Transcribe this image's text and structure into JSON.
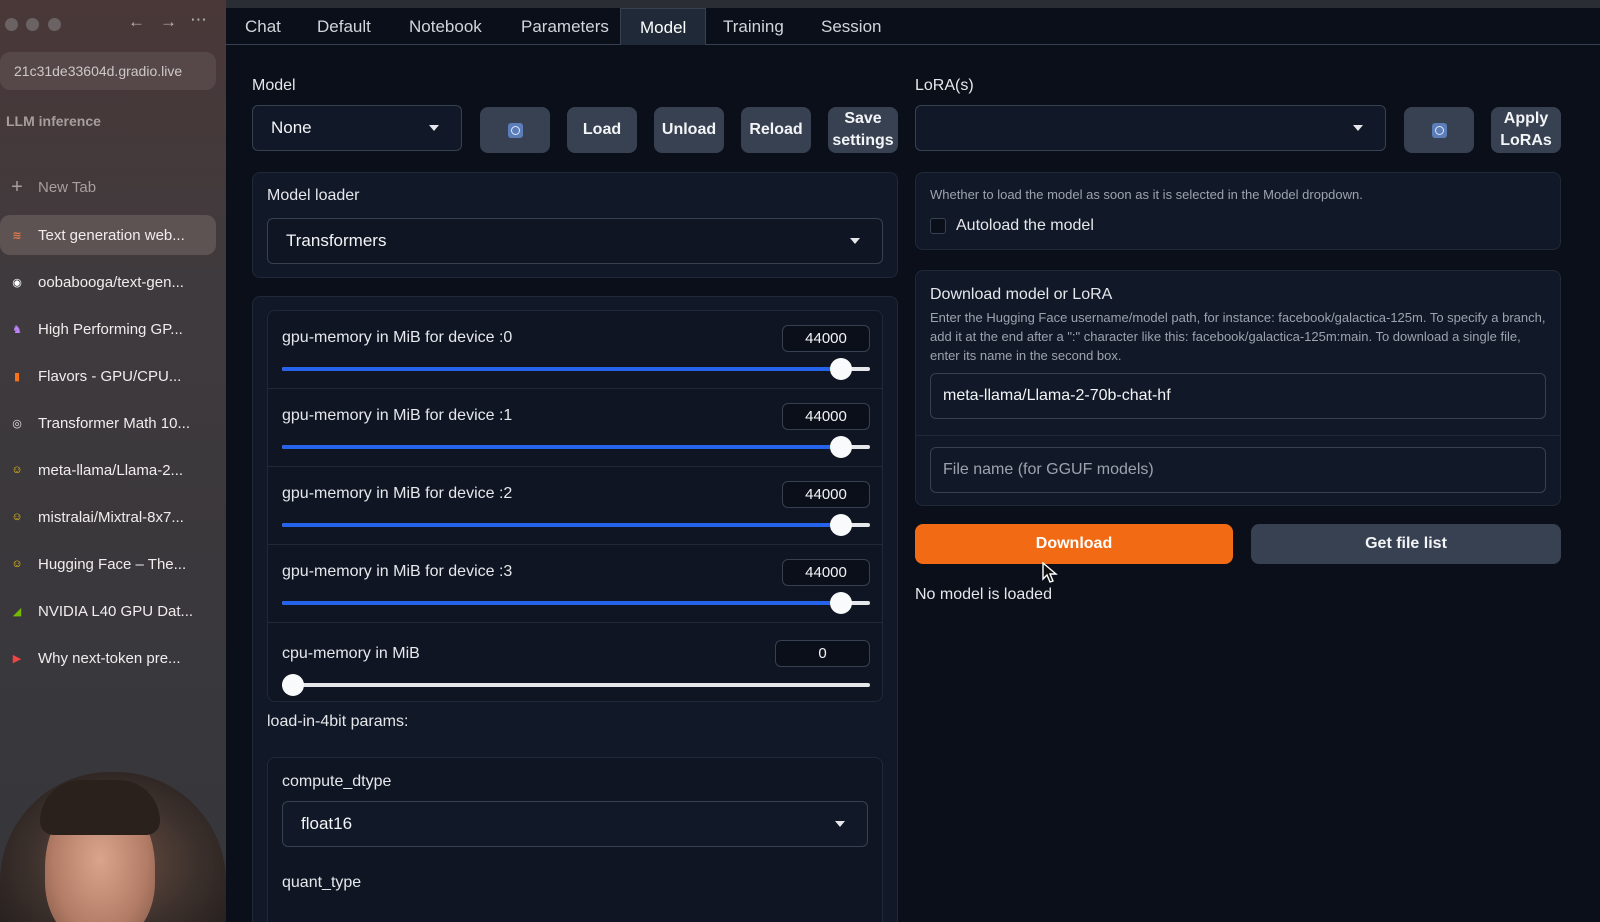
{
  "browser": {
    "url": "21c31de33604d.gradio.live",
    "space_name": "LLM inference",
    "new_tab_label": "New Tab",
    "tabs": [
      {
        "label": "Text generation web...",
        "icon": "stack-icon",
        "color": "#e07a4a",
        "active": true
      },
      {
        "label": "oobabooga/text-gen...",
        "icon": "github-icon",
        "color": "#ffffff",
        "active": false
      },
      {
        "label": "High Performing GP...",
        "icon": "fox-icon",
        "color": "#c084fc",
        "active": false
      },
      {
        "label": "Flavors - GPU/CPU...",
        "icon": "brand-icon",
        "color": "#f97316",
        "active": false
      },
      {
        "label": "Transformer Math 10...",
        "icon": "gear-circle-icon",
        "color": "#e5e7eb",
        "active": false
      },
      {
        "label": "meta-llama/Llama-2...",
        "icon": "hugging-face-icon",
        "color": "#facc15",
        "active": false
      },
      {
        "label": "mistralai/Mixtral-8x7...",
        "icon": "hugging-face-icon",
        "color": "#facc15",
        "active": false
      },
      {
        "label": "Hugging Face – The...",
        "icon": "hugging-face-icon",
        "color": "#facc15",
        "active": false
      },
      {
        "label": "NVIDIA L40 GPU Dat...",
        "icon": "nvidia-icon",
        "color": "#76b900",
        "active": false
      },
      {
        "label": "Why next-token pre...",
        "icon": "youtube-icon",
        "color": "#ef4444",
        "active": false
      }
    ]
  },
  "tabs": [
    "Chat",
    "Default",
    "Notebook",
    "Parameters",
    "Model",
    "Training",
    "Session"
  ],
  "selected_tab": "Model",
  "model": {
    "label": "Model",
    "selected": "None",
    "buttons": {
      "load": "Load",
      "unload": "Unload",
      "reload": "Reload",
      "save": "Save settings"
    }
  },
  "lora": {
    "label": "LoRA(s)",
    "selected": "",
    "apply_label": "Apply LoRAs"
  },
  "loader": {
    "label": "Model loader",
    "selected": "Transformers"
  },
  "gpu_memory": [
    {
      "label": "gpu-memory in MiB for device :0",
      "value": "44000",
      "fraction": 0.95
    },
    {
      "label": "gpu-memory in MiB for device :1",
      "value": "44000",
      "fraction": 0.95
    },
    {
      "label": "gpu-memory in MiB for device :2",
      "value": "44000",
      "fraction": 0.95
    },
    {
      "label": "gpu-memory in MiB for device :3",
      "value": "44000",
      "fraction": 0.95
    }
  ],
  "cpu_memory": {
    "label": "cpu-memory in MiB",
    "value": "0",
    "fraction": 0.0
  },
  "load_4bit": {
    "label": "load-in-4bit params:",
    "compute_dtype_label": "compute_dtype",
    "compute_dtype": "float16",
    "quant_type_label": "quant_type"
  },
  "autoload": {
    "info": "Whether to load the model as soon as it is selected in the Model dropdown.",
    "label": "Autoload the model",
    "checked": false
  },
  "download": {
    "title": "Download model or LoRA",
    "description": "Enter the Hugging Face username/model path, for instance: facebook/galactica-125m. To specify a branch, add it at the end after a \":\" character like this: facebook/galactica-125m:main. To download a single file, enter its name in the second box.",
    "model_path": "meta-llama/Llama-2-70b-chat-hf",
    "file_placeholder": "File name (for GGUF models)",
    "download_label": "Download",
    "file_list_label": "Get file list",
    "status": "No model is loaded"
  },
  "colors": {
    "accent": "#f26a14",
    "slider": "#2563eb"
  }
}
